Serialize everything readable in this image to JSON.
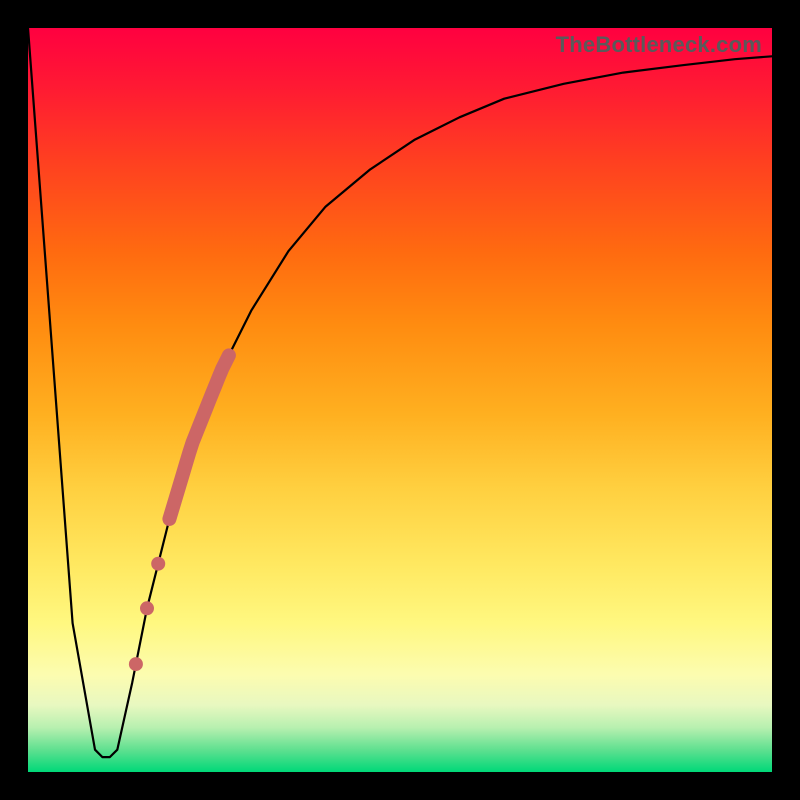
{
  "watermark": "TheBottleneck.com",
  "colors": {
    "accent_dots": "#cc6666",
    "curve": "#000000",
    "frame": "#000000"
  },
  "chart_data": {
    "type": "line",
    "title": "",
    "xlabel": "",
    "ylabel": "",
    "xlim": [
      0,
      100
    ],
    "ylim": [
      0,
      100
    ],
    "grid": false,
    "legend": false,
    "series": [
      {
        "name": "bottleneck-curve",
        "x": [
          0,
          3,
          6,
          9,
          10,
          11,
          12,
          14,
          16,
          19,
          22,
          26,
          30,
          35,
          40,
          46,
          52,
          58,
          64,
          72,
          80,
          88,
          95,
          100
        ],
        "values": [
          100,
          60,
          20,
          3,
          2,
          2,
          3,
          12,
          22,
          34,
          44,
          54,
          62,
          70,
          76,
          81,
          85,
          88,
          90.5,
          92.5,
          94,
          95,
          95.8,
          96.2
        ]
      }
    ],
    "annotations": {
      "highlight_band_on_curve": {
        "x_start": 19,
        "x_end": 27
      },
      "highlight_dots_on_curve_x": [
        17.5,
        16.0,
        14.5
      ]
    }
  }
}
